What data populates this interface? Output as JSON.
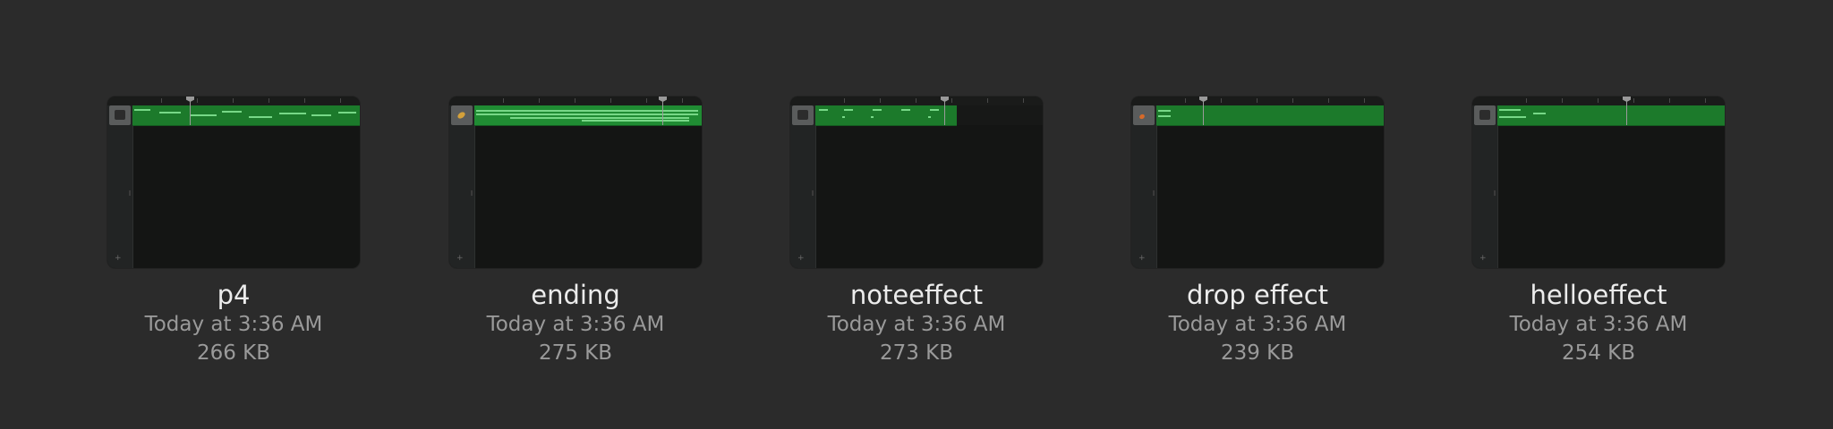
{
  "files": [
    {
      "name": "p4",
      "modified": "Today at 3:36 AM",
      "size": "266 KB",
      "track_icon": "drum-kit-icon"
    },
    {
      "name": "ending",
      "modified": "Today at 3:36 AM",
      "size": "275 KB",
      "track_icon": "guitar-icon"
    },
    {
      "name": "noteeffect",
      "modified": "Today at 3:36 AM",
      "size": "273 KB",
      "track_icon": "keyboard-icon"
    },
    {
      "name": "drop effect",
      "modified": "Today at 3:36 AM",
      "size": "239 KB",
      "track_icon": "guitar-icon"
    },
    {
      "name": "helloeffect",
      "modified": "Today at 3:36 AM",
      "size": "254 KB",
      "track_icon": "keyboard-icon"
    }
  ],
  "colors": {
    "background": "#2b2b2b",
    "region_green": "#1c7a2b",
    "note_green": "#77d887",
    "title_text": "#ececec",
    "meta_text": "#9a9a9a"
  }
}
